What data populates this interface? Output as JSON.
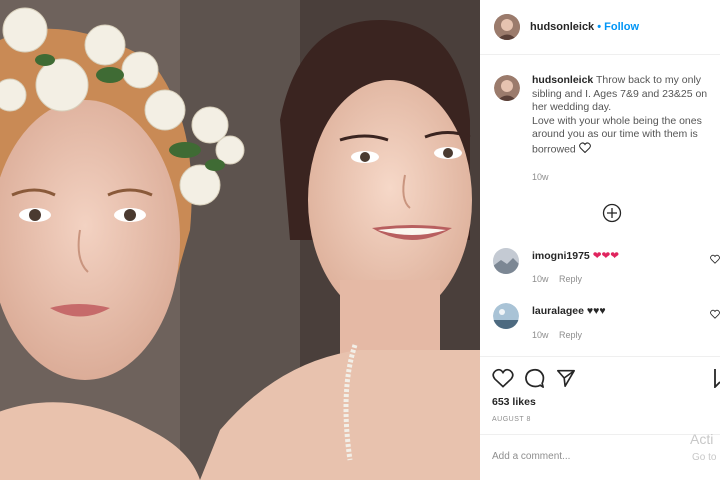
{
  "post": {
    "username": "hudsonleick",
    "follow_label": "Follow",
    "dot": "•",
    "caption_user": "hudsonleick",
    "caption_text": "Throw back to my only sibling and I. Ages 7&9 and 23&25 on her wedding day.",
    "caption_text2": "Love with your whole being the ones around you as our time with them is borrowed",
    "caption_time": "10w",
    "likes": "653 likes",
    "date": "AUGUST 8",
    "add_comment_placeholder": "Add a comment..."
  },
  "comments": [
    {
      "user": "imogni1975",
      "text": "❤❤❤",
      "time": "10w",
      "reply": "Reply",
      "color": "#e0245e"
    },
    {
      "user": "lauralagee",
      "text": "♥♥♥",
      "time": "10w",
      "reply": "Reply",
      "color": "#262626"
    }
  ],
  "watermark": {
    "line1": "Acti",
    "line2": "Go to"
  },
  "icons": {
    "load_more": "plus-circle-icon",
    "like": "heart-icon",
    "comment": "comment-icon",
    "share": "share-icon",
    "save": "bookmark-icon"
  },
  "colors": {
    "accent": "#0095f6",
    "text": "#262626",
    "muted": "#8e8e8e",
    "heart_red": "#e0245e"
  }
}
